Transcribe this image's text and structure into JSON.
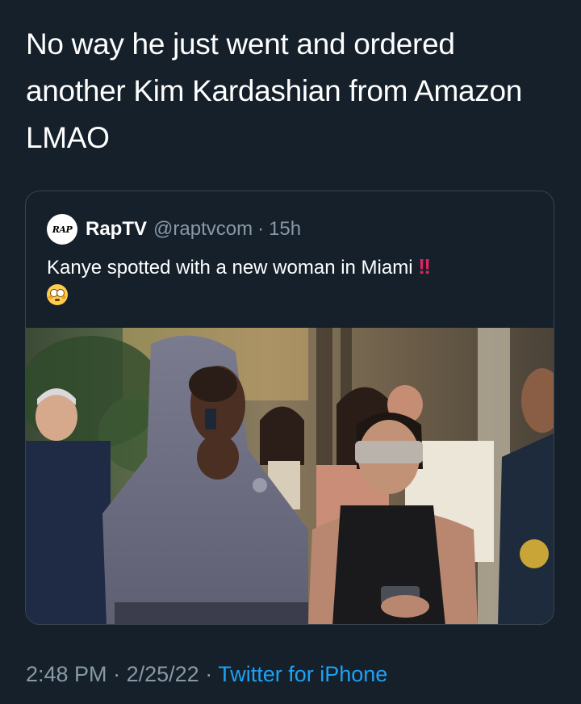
{
  "tweet": {
    "text": "No way he just went and ordered another Kim Kardashian from Amazon LMAO"
  },
  "quoted_tweet": {
    "avatar_text": "RAP",
    "display_name": "RapTV",
    "handle": "@raptvcom",
    "separator": "·",
    "time": "15h",
    "text": "Kanye spotted with a new woman in Miami",
    "emphasis": "‼",
    "emoji": "flushed-face-icon"
  },
  "meta": {
    "time": "2:48 PM",
    "sep1": "·",
    "date": "2/25/22",
    "sep2": "·",
    "source": "Twitter for iPhone"
  },
  "colors": {
    "background": "#15202b",
    "secondary_text": "#8899a6",
    "link": "#1da1f2",
    "border": "#38444d"
  }
}
